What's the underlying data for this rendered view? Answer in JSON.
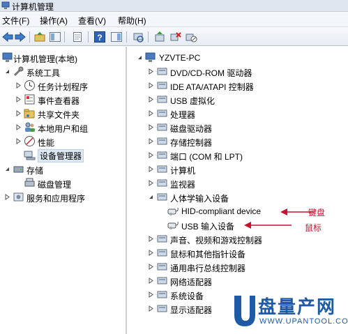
{
  "window": {
    "title": "计算机管理"
  },
  "menu": {
    "file": "文件(F)",
    "action": "操作(A)",
    "view": "查看(V)",
    "help": "帮助(H)"
  },
  "toolbar": {
    "icons": [
      "back-arrow-icon",
      "forward-arrow-icon",
      "up-folder-icon",
      "show-hide-tree-icon",
      "properties-icon",
      "help-icon",
      "show-hide-action-icon",
      "scan-hardware-icon",
      "update-driver-icon",
      "uninstall-icon",
      "disable-icon"
    ]
  },
  "left_tree": {
    "root": "计算机管理(本地)",
    "system_tools": "系统工具",
    "task_scheduler": "任务计划程序",
    "event_viewer": "事件查看器",
    "shared_folders": "共享文件夹",
    "local_users": "本地用户和组",
    "performance": "性能",
    "device_manager": "设备管理器",
    "storage": "存储",
    "disk_management": "磁盘管理",
    "services": "服务和应用程序"
  },
  "right_tree": {
    "root": "YZVTE-PC",
    "items": [
      "DVD/CD-ROM 驱动器",
      "IDE ATA/ATAPI 控制器",
      "USB 虚拟化",
      "处理器",
      "磁盘驱动器",
      "存储控制器",
      "端口 (COM 和 LPT)",
      "计算机",
      "监视器",
      "人体学输入设备"
    ],
    "hid_children": [
      "HID-compliant device",
      "USB 输入设备"
    ],
    "items_after": [
      "声音、视频和游戏控制器",
      "鼠标和其他指针设备",
      "通用串行总线控制器",
      "网络适配器",
      "系统设备",
      "显示适配器"
    ]
  },
  "annotations": {
    "keyboard": "键盘",
    "mouse": "鼠标"
  },
  "watermark": {
    "name": "盘量产网",
    "url": "WWW.UPANTOOL.COM"
  },
  "colors": {
    "annotation": "#c8102e",
    "logo": "#1f5aa6",
    "selected_bg": "#dde8f5"
  }
}
